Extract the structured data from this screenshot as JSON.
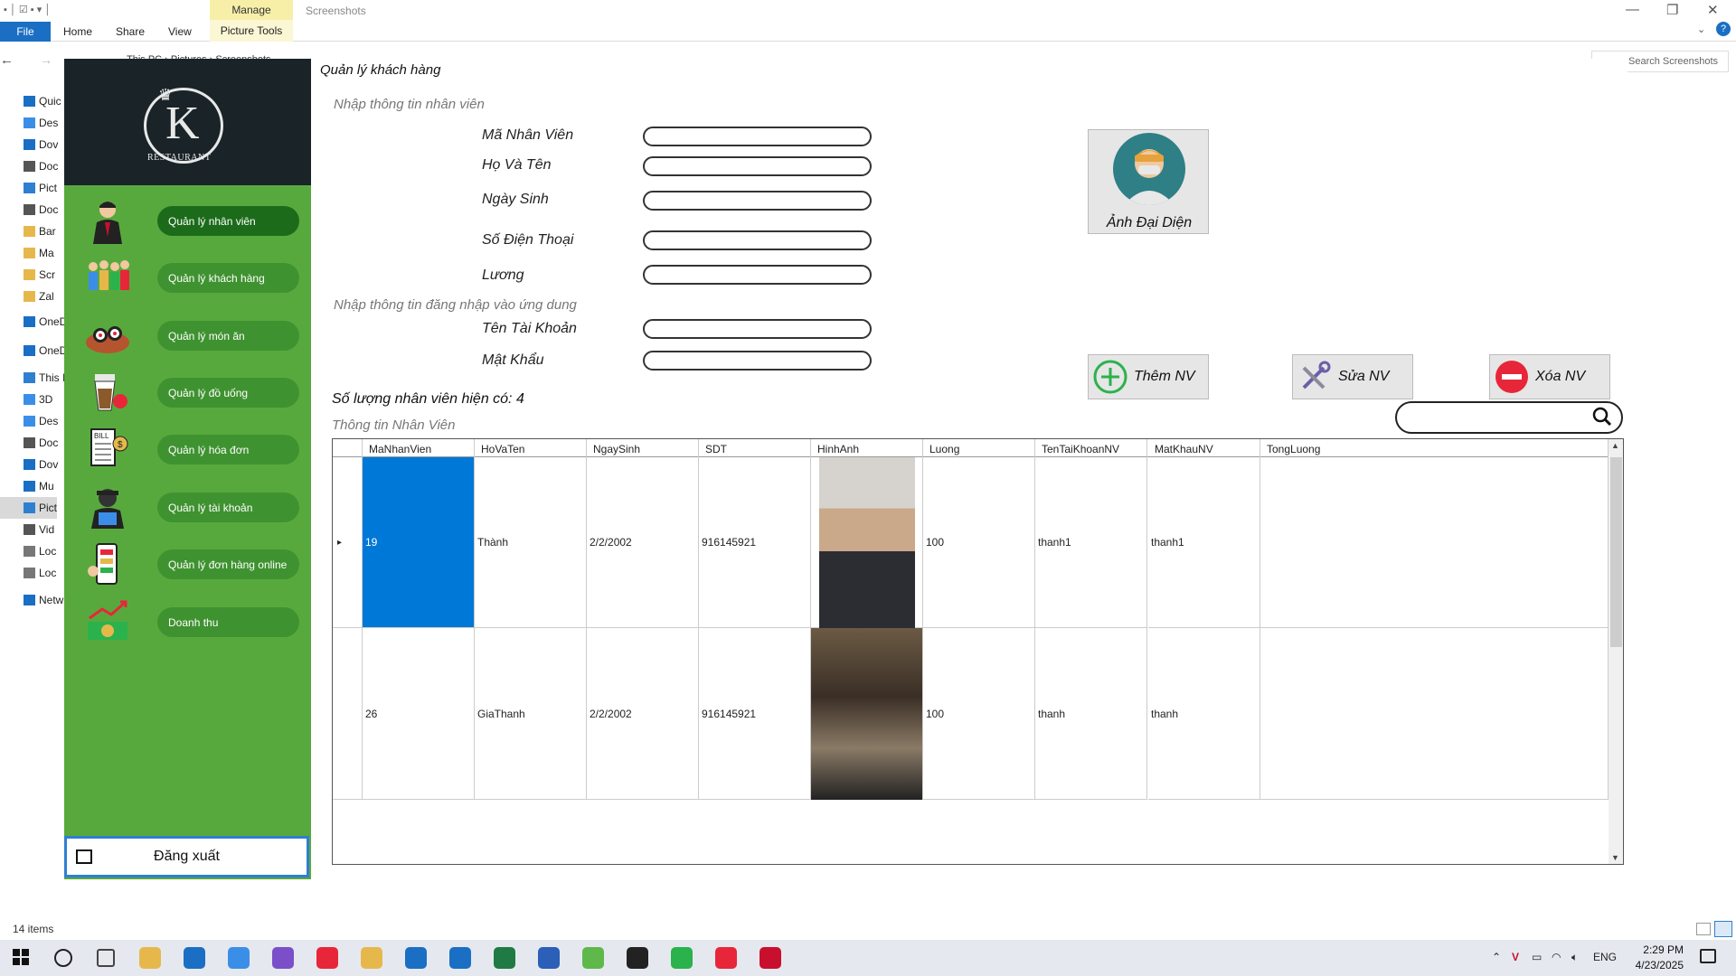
{
  "explorer": {
    "tabs": {
      "file": "File",
      "home": "Home",
      "share": "Share",
      "view": "View"
    },
    "manage": "Manage",
    "picture_tools": "Picture Tools",
    "window_title": "Screenshots",
    "address": "This PC  ›  Pictures  ›  Screenshots",
    "search_placeholder": "Search Screenshots",
    "nav": [
      "Quic",
      "Des",
      "Dov",
      "Doc",
      "Pict",
      "Doc",
      "Bar",
      "Ma",
      "Scr",
      "Zal",
      "OneD",
      "OneD",
      "This I",
      "3D",
      "Des",
      "Doc",
      "Dov",
      "Mu",
      "Pict",
      "Vid",
      "Loc",
      "Loc",
      "Netw"
    ],
    "status": "14 items"
  },
  "app": {
    "logo_text": "RESTAURANT",
    "menu": [
      {
        "label": "Quản lý nhân viên",
        "icon": "employee-icon",
        "active": true
      },
      {
        "label": "Quản lý khách hàng",
        "icon": "customers-icon",
        "active": false
      },
      {
        "label": "Quản lý món ăn",
        "icon": "sushi-icon",
        "active": false
      },
      {
        "label": "Quản lý đồ uống",
        "icon": "drink-icon",
        "active": false
      },
      {
        "label": "Quản lý hóa đơn",
        "icon": "bill-icon",
        "active": false
      },
      {
        "label": "Quản lý tài khoản",
        "icon": "account-icon",
        "active": false
      },
      {
        "label": "Quản lý đơn hàng online",
        "icon": "phone-order-icon",
        "active": false
      },
      {
        "label": "Doanh thu",
        "icon": "revenue-icon",
        "active": false
      }
    ],
    "logout": "Đăng xuất",
    "title": "Quản lý khách hàng",
    "section_employee": "Nhập thông tin nhân viên",
    "section_login": "Nhập thông tin đăng nhập vào ứng dung",
    "fields": {
      "ma_nv": "Mã Nhân Viên",
      "ho_ten": "Họ Và Tên",
      "ngay_sinh": "Ngày Sinh",
      "sdt": "Số Điện Thoại",
      "luong": "Lương",
      "tai_khoan": "Tên Tài Khoản",
      "mat_khau": "Mật Khẩu"
    },
    "avatar_label": "Ảnh Đại Diện",
    "buttons": {
      "add": "Thêm NV",
      "edit": "Sửa NV",
      "delete": "Xóa NV"
    },
    "count": "Số lượng nhân viên hiện có: 4",
    "info_title": "Thông tin Nhân Viên",
    "grid": {
      "columns": [
        "MaNhanVien",
        "HoVaTen",
        "NgaySinh",
        "SDT",
        "HinhAnh",
        "Luong",
        "TenTaiKhoanNV",
        "MatKhauNV",
        "TongLuong"
      ],
      "rows": [
        {
          "MaNhanVien": "19",
          "HoVaTen": "Thành",
          "NgaySinh": "2/2/2002",
          "SDT": "916145921",
          "Luong": "100",
          "TenTaiKhoanNV": "thanh1",
          "MatKhauNV": "thanh1",
          "TongLuong": ""
        },
        {
          "MaNhanVien": "26",
          "HoVaTen": "GiaThanh",
          "NgaySinh": "2/2/2002",
          "SDT": "916145921",
          "Luong": "100",
          "TenTaiKhoanNV": "thanh",
          "MatKhauNV": "thanh",
          "TongLuong": ""
        }
      ]
    }
  },
  "taskbar": {
    "time": "2:29 PM",
    "date": "4/23/2025",
    "lang": "ENG",
    "icons": [
      "search-icon",
      "task-view-icon",
      "file-explorer-icon",
      "store-icon",
      "app-store-icon",
      "visual-studio-icon",
      "chrome-icon",
      "paint-icon",
      "zalo-icon",
      "vscode-icon",
      "excel-icon",
      "word-icon",
      "clock-app-icon",
      "chatgpt-icon",
      "chrome-profile-icon",
      "chrome-profile-2-icon",
      "running-app-icon"
    ]
  },
  "colors": {
    "sidebar": "#58a93d",
    "menu_active": "#1c6b1a",
    "logo_bg": "#1a2428",
    "selected_cell": "#0078d7"
  }
}
